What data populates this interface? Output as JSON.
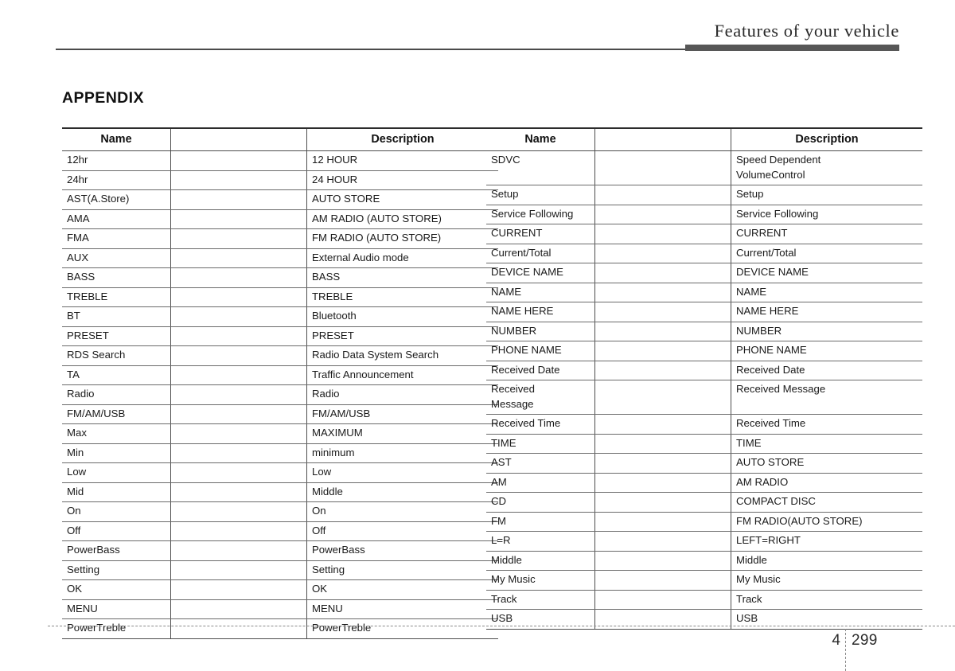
{
  "page": {
    "running_header": "Features of your vehicle",
    "section_title": "APPENDIX",
    "chapter_number": "4",
    "page_number": "299",
    "accent_color": "#575757",
    "rule_color": "#4a4a4a",
    "text_color": "#1a1a1a"
  },
  "tables": [
    {
      "id": "left",
      "headers": {
        "name": "Name",
        "middle": "",
        "description": "Description"
      },
      "rows": [
        {
          "name": "12hr",
          "middle": "",
          "description": "12 HOUR"
        },
        {
          "name": "24hr",
          "middle": "",
          "description": "24 HOUR"
        },
        {
          "name": "AST(A.Store)",
          "middle": "",
          "description": "AUTO STORE"
        },
        {
          "name": "AMA",
          "middle": "",
          "description": "AM RADIO (AUTO STORE)"
        },
        {
          "name": "FMA",
          "middle": "",
          "description": "FM RADIO (AUTO STORE)"
        },
        {
          "name": "AUX",
          "middle": "",
          "description": "External Audio mode"
        },
        {
          "name": "BASS",
          "middle": "",
          "description": "BASS"
        },
        {
          "name": "TREBLE",
          "middle": "",
          "description": "TREBLE"
        },
        {
          "name": "BT",
          "middle": "",
          "description": "Bluetooth"
        },
        {
          "name": "PRESET",
          "middle": "",
          "description": "PRESET"
        },
        {
          "name": "RDS Search",
          "middle": "",
          "description": "Radio Data System Search"
        },
        {
          "name": "TA",
          "middle": "",
          "description": "Traffic Announcement"
        },
        {
          "name": "Radio",
          "middle": "",
          "description": "Radio"
        },
        {
          "name": "FM/AM/USB",
          "middle": "",
          "description": "FM/AM/USB"
        },
        {
          "name": "Max",
          "middle": "",
          "description": "MAXIMUM"
        },
        {
          "name": "Min",
          "middle": "",
          "description": "minimum"
        },
        {
          "name": "Low",
          "middle": "",
          "description": "Low"
        },
        {
          "name": "Mid",
          "middle": "",
          "description": "Middle"
        },
        {
          "name": "On",
          "middle": "",
          "description": "On"
        },
        {
          "name": "Off",
          "middle": "",
          "description": "Off"
        },
        {
          "name": "PowerBass",
          "middle": "",
          "description": "PowerBass"
        },
        {
          "name": "Setting",
          "middle": "",
          "description": "Setting"
        },
        {
          "name": "OK",
          "middle": "",
          "description": "OK"
        },
        {
          "name": "MENU",
          "middle": "",
          "description": "MENU"
        },
        {
          "name": "PowerTreble",
          "middle": "",
          "description": "PowerTreble"
        }
      ]
    },
    {
      "id": "right",
      "headers": {
        "name": "Name",
        "middle": "",
        "description": "Description"
      },
      "rows": [
        {
          "name": "SDVC",
          "middle": "",
          "description": "Speed Dependent\nVolumeControl"
        },
        {
          "name": "Setup",
          "middle": "",
          "description": "Setup"
        },
        {
          "name": "Service Following",
          "middle": "",
          "description": "Service Following"
        },
        {
          "name": "CURRENT",
          "middle": "",
          "description": "CURRENT"
        },
        {
          "name": "Current/Total",
          "middle": "",
          "description": "Current/Total"
        },
        {
          "name": "DEVICE NAME",
          "middle": "",
          "description": "DEVICE NAME"
        },
        {
          "name": "NAME",
          "middle": "",
          "description": "NAME"
        },
        {
          "name": "NAME HERE",
          "middle": "",
          "description": "NAME HERE"
        },
        {
          "name": "NUMBER",
          "middle": "",
          "description": "NUMBER"
        },
        {
          "name": "PHONE NAME",
          "middle": "",
          "description": "PHONE NAME"
        },
        {
          "name": "Received Date",
          "middle": "",
          "description": "Received Date"
        },
        {
          "name": "Received\nMessage",
          "middle": "",
          "description": "Received Message"
        },
        {
          "name": "Received Time",
          "middle": "",
          "description": "Received Time"
        },
        {
          "name": "TIME",
          "middle": "",
          "description": "TIME"
        },
        {
          "name": "AST",
          "middle": "",
          "description": "AUTO STORE"
        },
        {
          "name": "AM",
          "middle": "",
          "description": "AM RADIO"
        },
        {
          "name": "CD",
          "middle": "",
          "description": "COMPACT DISC"
        },
        {
          "name": "FM",
          "middle": "",
          "description": "FM RADIO(AUTO STORE)"
        },
        {
          "name": "L=R",
          "middle": "",
          "description": "LEFT=RIGHT"
        },
        {
          "name": "Middle",
          "middle": "",
          "description": "Middle"
        },
        {
          "name": "My Music",
          "middle": "",
          "description": "My Music"
        },
        {
          "name": "Track",
          "middle": "",
          "description": "Track"
        },
        {
          "name": "USB",
          "middle": "",
          "description": "USB"
        }
      ]
    }
  ]
}
